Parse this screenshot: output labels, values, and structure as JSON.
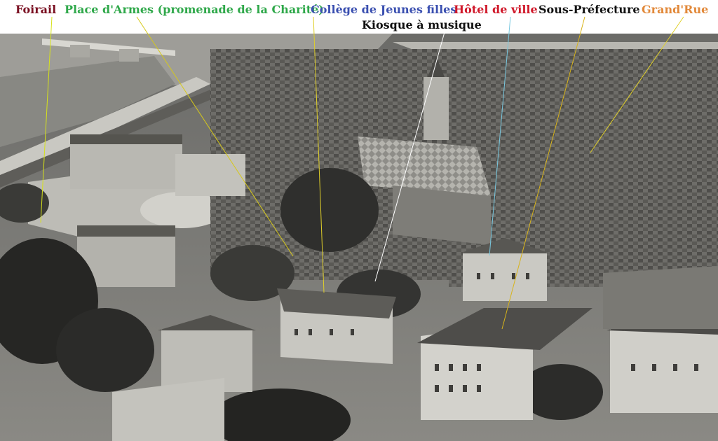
{
  "labels": [
    {
      "id": "foirail",
      "text": "Foirail",
      "color": "#7a1022"
    },
    {
      "id": "place-d-armes",
      "text": "Place d'Armes (promenade de la Charité)",
      "color": "#2fa84a"
    },
    {
      "id": "college",
      "text": "Collège de Jeunes filles",
      "color": "#3a4fb0"
    },
    {
      "id": "hotel-de-ville",
      "text": "Hôtel de ville",
      "color": "#d0182a"
    },
    {
      "id": "sous-prefecture",
      "text": "Sous-Préfecture",
      "color": "#111111"
    },
    {
      "id": "grand-rue",
      "text": "Grand'Rue",
      "color": "#e2893a"
    },
    {
      "id": "kiosque",
      "text": "Kiosque à musique",
      "color": "#111111"
    }
  ],
  "photo": {
    "description_icon": "aerial-town-photo"
  }
}
